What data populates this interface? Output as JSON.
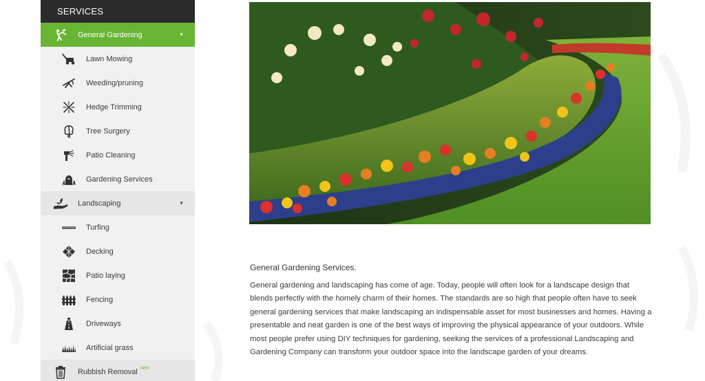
{
  "sidebar": {
    "header": "SERVICES",
    "items": [
      {
        "label": "General Gardening",
        "icon": "gardener-icon",
        "type": "category",
        "active": true
      },
      {
        "label": "Lawn Mowing",
        "icon": "lawn-mower-icon",
        "type": "sub"
      },
      {
        "label": "Weeding/pruning",
        "icon": "pruning-shears-icon",
        "type": "sub"
      },
      {
        "label": "Hedge Trimming",
        "icon": "hedge-trimmer-icon",
        "type": "sub"
      },
      {
        "label": "Tree Surgery",
        "icon": "tree-icon",
        "type": "sub"
      },
      {
        "label": "Patio Cleaning",
        "icon": "pressure-washer-icon",
        "type": "sub"
      },
      {
        "label": "Gardening Services",
        "icon": "garden-plants-icon",
        "type": "sub"
      },
      {
        "label": "Landscaping",
        "icon": "hand-plant-icon",
        "type": "category"
      },
      {
        "label": "Turfing",
        "icon": "turf-icon",
        "type": "sub"
      },
      {
        "label": "Decking",
        "icon": "decking-icon",
        "type": "sub"
      },
      {
        "label": "Patio laying",
        "icon": "paving-stones-icon",
        "type": "sub"
      },
      {
        "label": "Fencing",
        "icon": "fence-icon",
        "type": "sub"
      },
      {
        "label": "Driveways",
        "icon": "driveway-icon",
        "type": "sub"
      },
      {
        "label": "Artificial grass",
        "icon": "grass-icon",
        "type": "sub"
      },
      {
        "label": "Rubbish Removal",
        "icon": "trash-can-icon",
        "type": "category",
        "badge": "new"
      }
    ],
    "caret": "▼"
  },
  "hero_image": {
    "subject": "flower-bed-hedge-lawn-photo"
  },
  "content": {
    "title": "General Gardening Services.",
    "body": "General gardening and landscaping has come of age. Today, people will often look for a landscape design that blends perfectly with the homely charm of their homes. The standards are so high that people often have to seek general gardening services that make landscaping an indispensable asset for most businesses and homes. Having a presentable and neat garden is one of the best ways of improving the physical appearance of your outdoors. While most people prefer using DIY techniques for gardening, seeking the services of a professional Landscaping and Gardening Company can transform your outdoor space into the landscape garden of your dreams."
  },
  "colors": {
    "accent_green": "#68b534",
    "sidebar_header": "#2b2b2b",
    "sidebar_bg": "#f1f1f1"
  }
}
